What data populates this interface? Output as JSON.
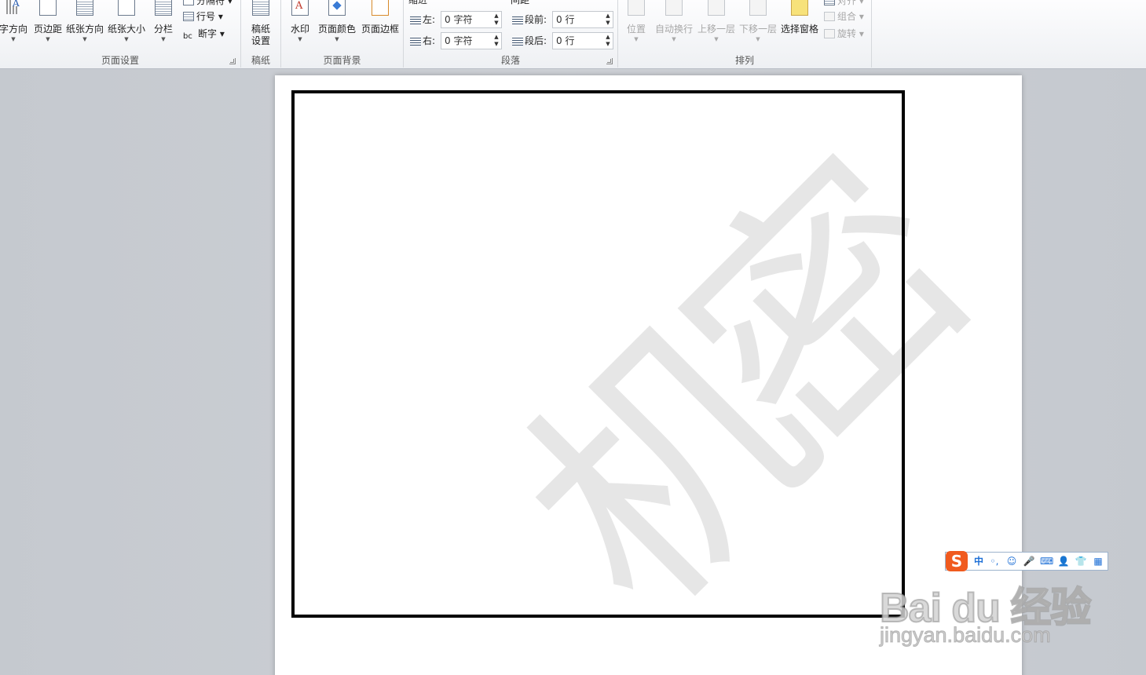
{
  "ribbon": {
    "page_setup": {
      "label": "页面设置",
      "text_direction": "字方向",
      "margins": "页边距",
      "orientation": "纸张方向",
      "size": "纸张大小",
      "columns": "分栏",
      "breaks": "分隔符",
      "line_numbers": "行号",
      "hyphenation": "断字"
    },
    "manuscript": {
      "label": "稿纸",
      "button": "稿纸\n设置",
      "button_line1": "稿纸",
      "button_line2": "设置"
    },
    "page_background": {
      "label": "页面背景",
      "watermark": "水印",
      "page_color": "页面颜色",
      "page_borders": "页面边框"
    },
    "paragraph": {
      "label": "段落",
      "indent_header": "缩进",
      "spacing_header": "间距",
      "indent_left_label": "左:",
      "indent_left_value": "0 字符",
      "indent_right_label": "右:",
      "indent_right_value": "0 字符",
      "spacing_before_label": "段前:",
      "spacing_before_value": "0 行",
      "spacing_after_label": "段后:",
      "spacing_after_value": "0 行"
    },
    "arrange": {
      "label": "排列",
      "position": "位置",
      "wrap_text": "自动换行",
      "bring_forward": "上移一层",
      "send_backward": "下移一层",
      "selection_pane": "选择窗格",
      "align": "对齐",
      "group": "组合",
      "rotate": "旋转"
    }
  },
  "document": {
    "watermark_text": "机密"
  },
  "ime": {
    "logo": "S",
    "mode": "中"
  },
  "overlay": {
    "brand": "Bai du 经验",
    "url": "jingyan.baidu.com"
  },
  "colors": {
    "ime_logo": "#f05a1e",
    "ime_icons": "#1d6fd6",
    "frame_border": "#000000",
    "watermark": "#e6e6e6"
  }
}
